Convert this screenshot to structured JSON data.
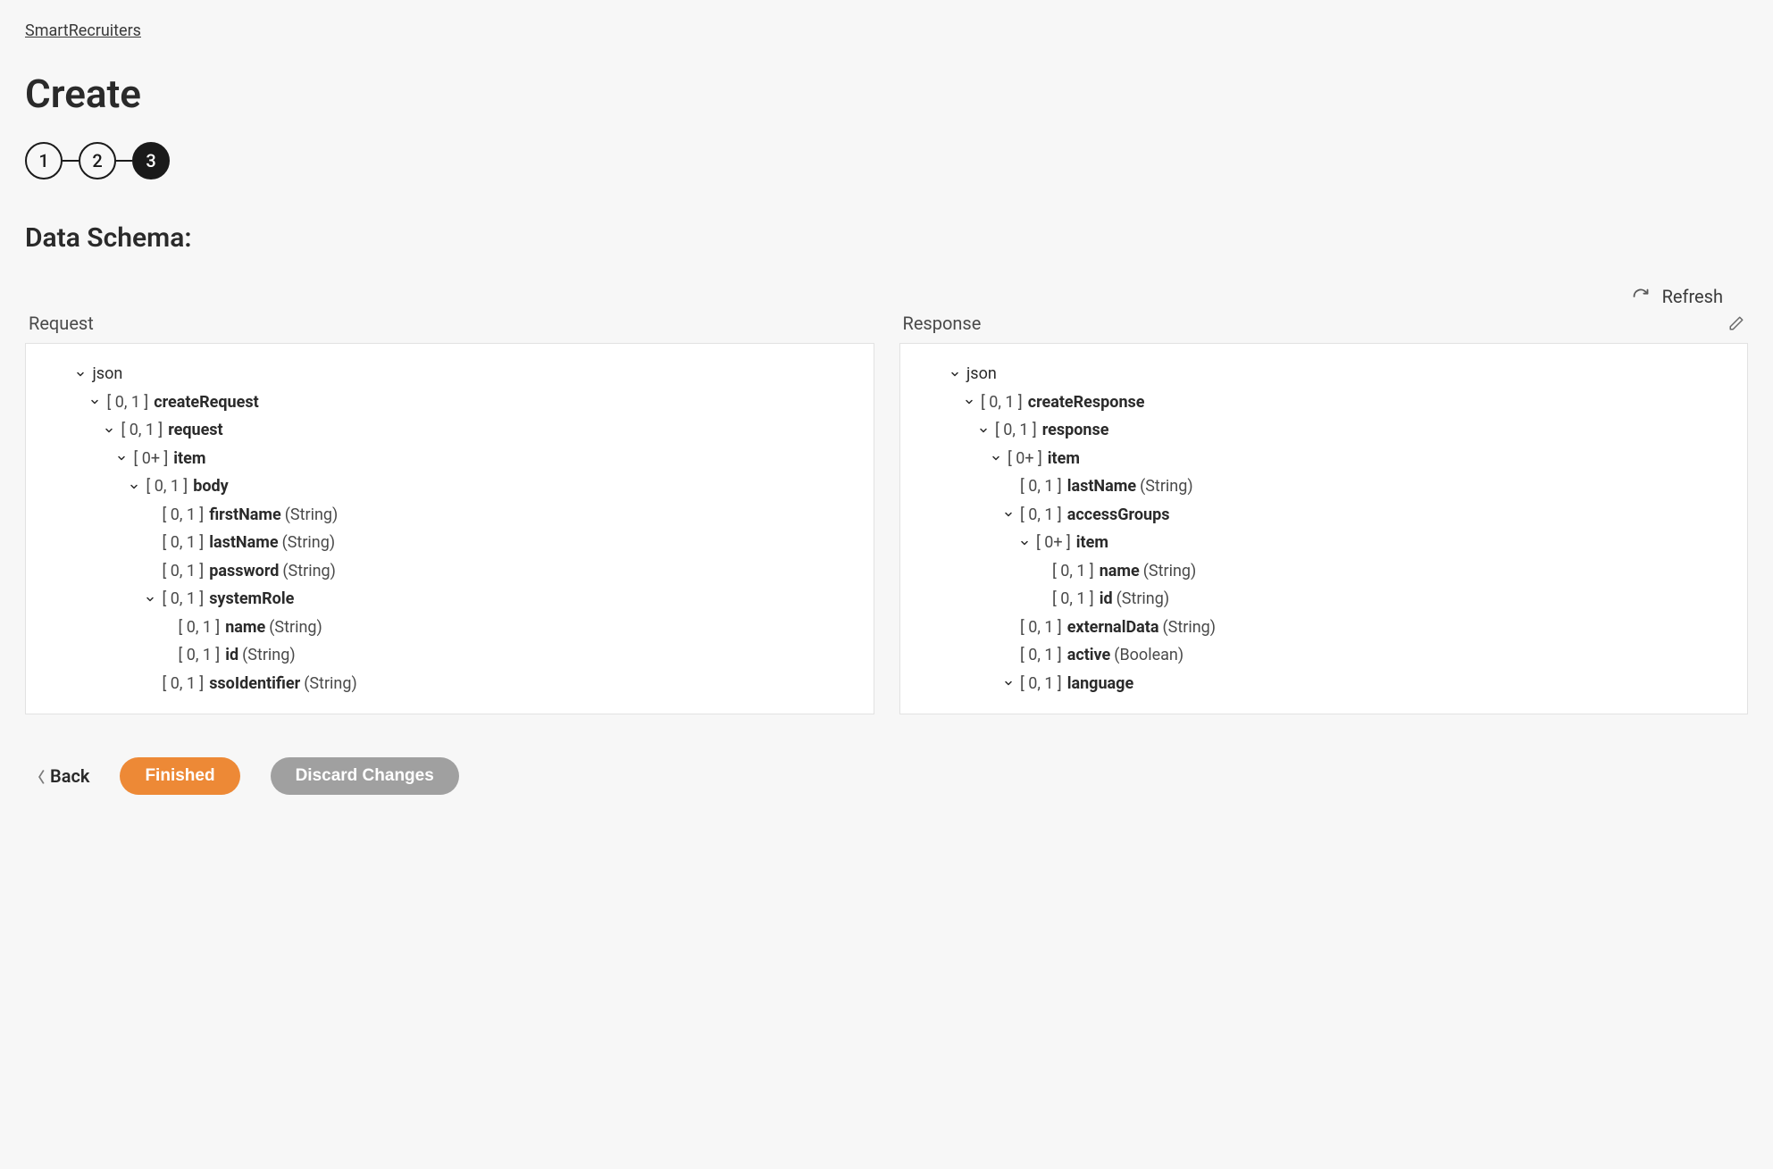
{
  "breadcrumb": "SmartRecruiters",
  "page_title": "Create",
  "stepper": {
    "steps": [
      "1",
      "2",
      "3"
    ],
    "active_index": 2
  },
  "section_title": "Data Schema:",
  "refresh_label": "Refresh",
  "panels": {
    "request_title": "Request",
    "response_title": "Response"
  },
  "request_tree": [
    {
      "indent": 0,
      "chevron": true,
      "card": "",
      "name": "json",
      "bold": false,
      "type": ""
    },
    {
      "indent": 1,
      "chevron": true,
      "card": "[ 0, 1 ]",
      "name": "createRequest",
      "bold": true,
      "type": ""
    },
    {
      "indent": 2,
      "chevron": true,
      "card": "[ 0, 1 ]",
      "name": "request",
      "bold": true,
      "type": ""
    },
    {
      "indent": 3,
      "chevron": true,
      "card": "[ 0+ ]",
      "name": "item",
      "bold": true,
      "type": ""
    },
    {
      "indent": 4,
      "chevron": true,
      "card": "[ 0, 1 ]",
      "name": "body",
      "bold": true,
      "type": ""
    },
    {
      "indent": 5,
      "chevron": false,
      "card": "[ 0, 1 ]",
      "name": "firstName",
      "bold": true,
      "type": "(String)"
    },
    {
      "indent": 5,
      "chevron": false,
      "card": "[ 0, 1 ]",
      "name": "lastName",
      "bold": true,
      "type": "(String)"
    },
    {
      "indent": 5,
      "chevron": false,
      "card": "[ 0, 1 ]",
      "name": "password",
      "bold": true,
      "type": "(String)"
    },
    {
      "indent": 5,
      "chevron": true,
      "card": "[ 0, 1 ]",
      "name": "systemRole",
      "bold": true,
      "type": ""
    },
    {
      "indent": 6,
      "chevron": false,
      "card": "[ 0, 1 ]",
      "name": "name",
      "bold": true,
      "type": "(String)"
    },
    {
      "indent": 6,
      "chevron": false,
      "card": "[ 0, 1 ]",
      "name": "id",
      "bold": true,
      "type": "(String)"
    },
    {
      "indent": 5,
      "chevron": false,
      "card": "[ 0, 1 ]",
      "name": "ssoIdentifier",
      "bold": true,
      "type": "(String)"
    }
  ],
  "response_tree": [
    {
      "indent": 0,
      "chevron": true,
      "card": "",
      "name": "json",
      "bold": false,
      "type": ""
    },
    {
      "indent": 1,
      "chevron": true,
      "card": "[ 0, 1 ]",
      "name": "createResponse",
      "bold": true,
      "type": ""
    },
    {
      "indent": 2,
      "chevron": true,
      "card": "[ 0, 1 ]",
      "name": "response",
      "bold": true,
      "type": ""
    },
    {
      "indent": 3,
      "chevron": true,
      "card": "[ 0+ ]",
      "name": "item",
      "bold": true,
      "type": ""
    },
    {
      "indent": 4,
      "chevron": false,
      "card": "[ 0, 1 ]",
      "name": "lastName",
      "bold": true,
      "type": "(String)"
    },
    {
      "indent": 4,
      "chevron": true,
      "card": "[ 0, 1 ]",
      "name": "accessGroups",
      "bold": true,
      "type": ""
    },
    {
      "indent": 5,
      "chevron": true,
      "card": "[ 0+ ]",
      "name": "item",
      "bold": true,
      "type": ""
    },
    {
      "indent": 6,
      "chevron": false,
      "card": "[ 0, 1 ]",
      "name": "name",
      "bold": true,
      "type": "(String)"
    },
    {
      "indent": 6,
      "chevron": false,
      "card": "[ 0, 1 ]",
      "name": "id",
      "bold": true,
      "type": "(String)"
    },
    {
      "indent": 4,
      "chevron": false,
      "card": "[ 0, 1 ]",
      "name": "externalData",
      "bold": true,
      "type": "(String)"
    },
    {
      "indent": 4,
      "chevron": false,
      "card": "[ 0, 1 ]",
      "name": "active",
      "bold": true,
      "type": "(Boolean)"
    },
    {
      "indent": 4,
      "chevron": true,
      "card": "[ 0, 1 ]",
      "name": "language",
      "bold": true,
      "type": ""
    }
  ],
  "footer": {
    "back": "Back",
    "finished": "Finished",
    "discard": "Discard Changes"
  }
}
